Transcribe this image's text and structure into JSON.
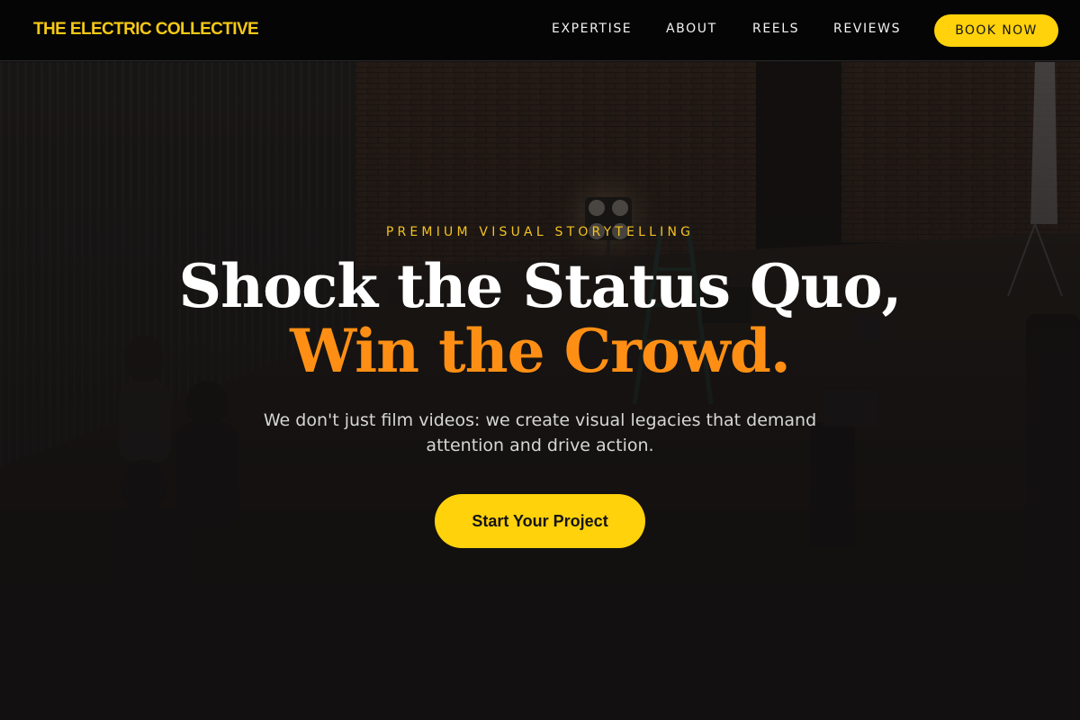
{
  "nav": {
    "logo": "THE ELECTRIC COLLECTIVE",
    "links": [
      {
        "label": "EXPERTISE"
      },
      {
        "label": "ABOUT"
      },
      {
        "label": "REELS"
      },
      {
        "label": "REVIEWS"
      }
    ],
    "book_label": "BOOK NOW"
  },
  "hero": {
    "eyebrow": "PREMIUM VISUAL STORYTELLING",
    "headline_line1": "Shock the Status Quo,",
    "headline_line2": "Win the Crowd.",
    "subtitle": "We don't just film videos: we create visual legacies that demand attention and drive action.",
    "cta_label": "Start Your Project"
  },
  "colors": {
    "brand_yellow": "#ffd20b",
    "accent_orange": "#ff8f14",
    "nav_background": "#050505",
    "hero_overlay": "#121010"
  }
}
